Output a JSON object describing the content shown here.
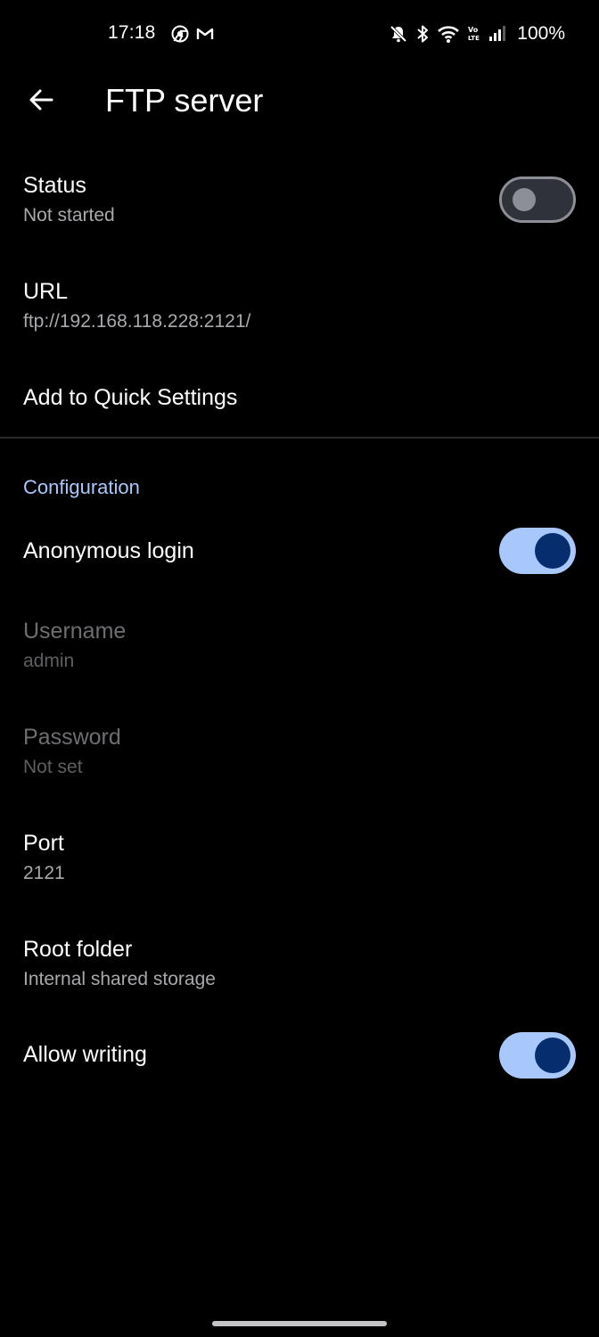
{
  "status_bar": {
    "time": "17:18",
    "notification_icons": [
      "chrome-icon",
      "gmail-icon"
    ],
    "status_icons": [
      "mute-icon",
      "bluetooth-icon",
      "wifi-icon",
      "volte-icon",
      "signal-icon"
    ],
    "battery": "100%"
  },
  "app_bar": {
    "back_icon": "arrow-back-icon",
    "title": "FTP server"
  },
  "prefs": {
    "status": {
      "title": "Status",
      "summary": "Not started",
      "enabled": false
    },
    "url": {
      "title": "URL",
      "summary": "ftp://192.168.118.228:2121/"
    },
    "quick_settings": {
      "title": "Add to Quick Settings"
    },
    "category": "Configuration",
    "anonymous": {
      "title": "Anonymous login",
      "enabled": true
    },
    "username": {
      "title": "Username",
      "summary": "admin"
    },
    "password": {
      "title": "Password",
      "summary": "Not set"
    },
    "port": {
      "title": "Port",
      "summary": "2121"
    },
    "root": {
      "title": "Root folder",
      "summary": "Internal shared storage"
    },
    "writing": {
      "title": "Allow writing",
      "enabled": true
    }
  },
  "colors": {
    "background": "#000000",
    "accent": "#a8c7fa",
    "switch_thumb_on": "#062e6f",
    "text_primary": "#ffffff",
    "text_secondary": "#a9a9ad"
  }
}
